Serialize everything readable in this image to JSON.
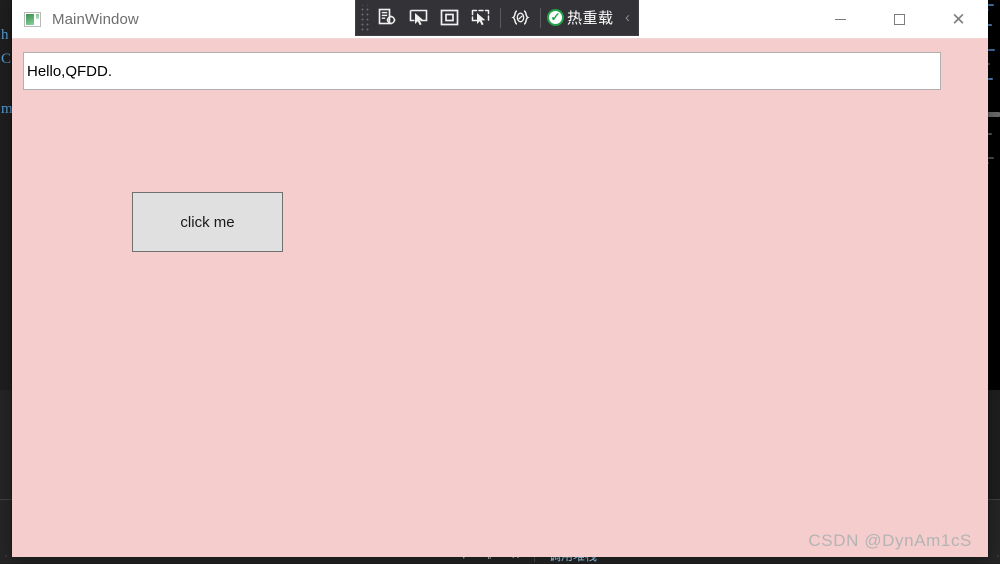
{
  "window": {
    "title": "MainWindow",
    "app_icon": "qt-app-icon",
    "controls": {
      "minimize_label": "—",
      "maximize_label": "□",
      "close_label": "✕"
    }
  },
  "vs_toolbar": {
    "grip": "drag-handle",
    "buttons": [
      {
        "name": "show-live-visual-tree-icon",
        "glyph": "live-visual-tree"
      },
      {
        "name": "select-element-icon",
        "glyph": "cursor-in-frame"
      },
      {
        "name": "display-layout-adorners-icon",
        "glyph": "square-outline"
      },
      {
        "name": "track-focused-element-icon",
        "glyph": "dashed-frame-cursor"
      }
    ],
    "xaml_button": {
      "name": "xaml-designer-icon",
      "glyph": "{}"
    },
    "hot_reload": {
      "label": "热重载",
      "icon": "check-circle-icon",
      "accent_color": "#22a34a"
    },
    "collapse_label": "‹"
  },
  "client": {
    "background_color": "#f5cdcd",
    "text_field": {
      "value": "Hello,QFDD.",
      "placeholder": ""
    },
    "button": {
      "label": "click me"
    }
  },
  "watermark": {
    "text": "CSDN @DynAm1cS"
  },
  "ide_background": {
    "code_fragments": [
      "h",
      "C",
      "m"
    ],
    "bottom_panel_tab": "调用堆栈",
    "dock_controls": [
      "▾",
      "‖",
      "✕"
    ]
  }
}
